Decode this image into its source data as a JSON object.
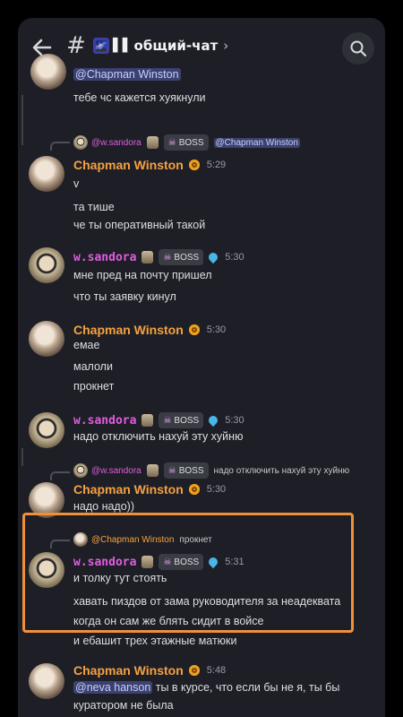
{
  "header": {
    "channel_emoji": "🌌",
    "channel_name": "общий-чат",
    "back_icon": "arrow-left-icon",
    "search_icon": "search-icon"
  },
  "colors": {
    "background": "#1e1f26",
    "chapman": "#f5a142",
    "sandora": "#e05ce0",
    "mention_bg": "#3c4270",
    "highlight": "#f0913a"
  },
  "messages": {
    "m0": {
      "mention": "@Chapman Winston",
      "line1": "тебе чс кажется хуякнули"
    },
    "m1": {
      "reply_author": "@w.sandora",
      "reply_badge": "BOSS",
      "reply_mention": "@Chapman Winston",
      "author": "Chapman Winston",
      "time": "5:29",
      "lines": [
        "v",
        "та тише",
        "че ты оперативный такой"
      ]
    },
    "m2": {
      "author": "w.sandora",
      "badge": "BOSS",
      "time": "5:30",
      "lines": [
        "мне пред на почту пришел",
        "что ты заявку кинул"
      ]
    },
    "m3": {
      "author": "Chapman Winston",
      "time": "5:30",
      "lines": [
        "емае",
        "малоли",
        "прокнет"
      ]
    },
    "m4": {
      "author": "w.sandora",
      "badge": "BOSS",
      "time": "5:30",
      "lines": [
        "надо отключить нахуй эту хуйню"
      ]
    },
    "m5": {
      "reply_author": "@w.sandora",
      "reply_badge": "BOSS",
      "reply_text": "надо отключить нахуй эту хуйню",
      "author": "Chapman Winston",
      "time": "5:30",
      "lines": [
        "надо надо))"
      ]
    },
    "m6": {
      "reply_author": "@Chapman Winston",
      "reply_text": "прокнет",
      "author": "w.sandora",
      "badge": "BOSS",
      "time": "5:31",
      "lines": [
        "и толку тут стоять",
        "хавать пиздов от зама руководителя за неадеквата",
        "когда он сам же блять сидит в войсе",
        "и ебашит трех этажные матюки"
      ]
    },
    "m7": {
      "author": "Chapman Winston",
      "time": "5:48",
      "mention": "@neva hanson",
      "line1_rest": " ты в курсе, что если бы не я, ты бы",
      "line2": "куратором не была"
    }
  }
}
